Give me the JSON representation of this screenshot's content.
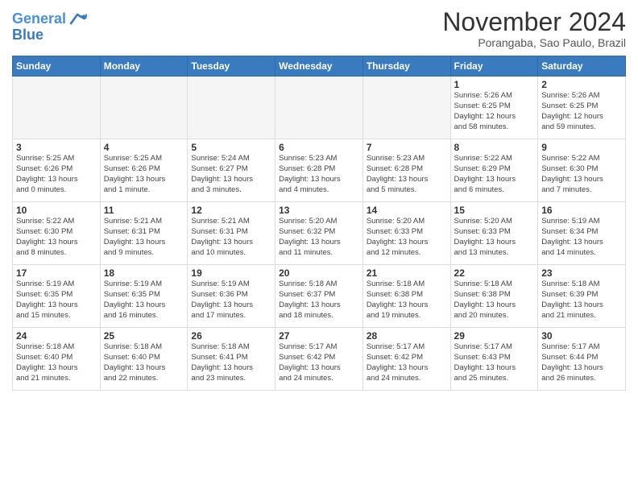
{
  "header": {
    "logo_line1": "General",
    "logo_line2": "Blue",
    "month_title": "November 2024",
    "location": "Porangaba, Sao Paulo, Brazil"
  },
  "days_of_week": [
    "Sunday",
    "Monday",
    "Tuesday",
    "Wednesday",
    "Thursday",
    "Friday",
    "Saturday"
  ],
  "weeks": [
    [
      {
        "day": "",
        "info": ""
      },
      {
        "day": "",
        "info": ""
      },
      {
        "day": "",
        "info": ""
      },
      {
        "day": "",
        "info": ""
      },
      {
        "day": "",
        "info": ""
      },
      {
        "day": "1",
        "info": "Sunrise: 5:26 AM\nSunset: 6:25 PM\nDaylight: 12 hours\nand 58 minutes."
      },
      {
        "day": "2",
        "info": "Sunrise: 5:26 AM\nSunset: 6:25 PM\nDaylight: 12 hours\nand 59 minutes."
      }
    ],
    [
      {
        "day": "3",
        "info": "Sunrise: 5:25 AM\nSunset: 6:26 PM\nDaylight: 13 hours\nand 0 minutes."
      },
      {
        "day": "4",
        "info": "Sunrise: 5:25 AM\nSunset: 6:26 PM\nDaylight: 13 hours\nand 1 minute."
      },
      {
        "day": "5",
        "info": "Sunrise: 5:24 AM\nSunset: 6:27 PM\nDaylight: 13 hours\nand 3 minutes."
      },
      {
        "day": "6",
        "info": "Sunrise: 5:23 AM\nSunset: 6:28 PM\nDaylight: 13 hours\nand 4 minutes."
      },
      {
        "day": "7",
        "info": "Sunrise: 5:23 AM\nSunset: 6:28 PM\nDaylight: 13 hours\nand 5 minutes."
      },
      {
        "day": "8",
        "info": "Sunrise: 5:22 AM\nSunset: 6:29 PM\nDaylight: 13 hours\nand 6 minutes."
      },
      {
        "day": "9",
        "info": "Sunrise: 5:22 AM\nSunset: 6:30 PM\nDaylight: 13 hours\nand 7 minutes."
      }
    ],
    [
      {
        "day": "10",
        "info": "Sunrise: 5:22 AM\nSunset: 6:30 PM\nDaylight: 13 hours\nand 8 minutes."
      },
      {
        "day": "11",
        "info": "Sunrise: 5:21 AM\nSunset: 6:31 PM\nDaylight: 13 hours\nand 9 minutes."
      },
      {
        "day": "12",
        "info": "Sunrise: 5:21 AM\nSunset: 6:31 PM\nDaylight: 13 hours\nand 10 minutes."
      },
      {
        "day": "13",
        "info": "Sunrise: 5:20 AM\nSunset: 6:32 PM\nDaylight: 13 hours\nand 11 minutes."
      },
      {
        "day": "14",
        "info": "Sunrise: 5:20 AM\nSunset: 6:33 PM\nDaylight: 13 hours\nand 12 minutes."
      },
      {
        "day": "15",
        "info": "Sunrise: 5:20 AM\nSunset: 6:33 PM\nDaylight: 13 hours\nand 13 minutes."
      },
      {
        "day": "16",
        "info": "Sunrise: 5:19 AM\nSunset: 6:34 PM\nDaylight: 13 hours\nand 14 minutes."
      }
    ],
    [
      {
        "day": "17",
        "info": "Sunrise: 5:19 AM\nSunset: 6:35 PM\nDaylight: 13 hours\nand 15 minutes."
      },
      {
        "day": "18",
        "info": "Sunrise: 5:19 AM\nSunset: 6:35 PM\nDaylight: 13 hours\nand 16 minutes."
      },
      {
        "day": "19",
        "info": "Sunrise: 5:19 AM\nSunset: 6:36 PM\nDaylight: 13 hours\nand 17 minutes."
      },
      {
        "day": "20",
        "info": "Sunrise: 5:18 AM\nSunset: 6:37 PM\nDaylight: 13 hours\nand 18 minutes."
      },
      {
        "day": "21",
        "info": "Sunrise: 5:18 AM\nSunset: 6:38 PM\nDaylight: 13 hours\nand 19 minutes."
      },
      {
        "day": "22",
        "info": "Sunrise: 5:18 AM\nSunset: 6:38 PM\nDaylight: 13 hours\nand 20 minutes."
      },
      {
        "day": "23",
        "info": "Sunrise: 5:18 AM\nSunset: 6:39 PM\nDaylight: 13 hours\nand 21 minutes."
      }
    ],
    [
      {
        "day": "24",
        "info": "Sunrise: 5:18 AM\nSunset: 6:40 PM\nDaylight: 13 hours\nand 21 minutes."
      },
      {
        "day": "25",
        "info": "Sunrise: 5:18 AM\nSunset: 6:40 PM\nDaylight: 13 hours\nand 22 minutes."
      },
      {
        "day": "26",
        "info": "Sunrise: 5:18 AM\nSunset: 6:41 PM\nDaylight: 13 hours\nand 23 minutes."
      },
      {
        "day": "27",
        "info": "Sunrise: 5:17 AM\nSunset: 6:42 PM\nDaylight: 13 hours\nand 24 minutes."
      },
      {
        "day": "28",
        "info": "Sunrise: 5:17 AM\nSunset: 6:42 PM\nDaylight: 13 hours\nand 24 minutes."
      },
      {
        "day": "29",
        "info": "Sunrise: 5:17 AM\nSunset: 6:43 PM\nDaylight: 13 hours\nand 25 minutes."
      },
      {
        "day": "30",
        "info": "Sunrise: 5:17 AM\nSunset: 6:44 PM\nDaylight: 13 hours\nand 26 minutes."
      }
    ]
  ]
}
